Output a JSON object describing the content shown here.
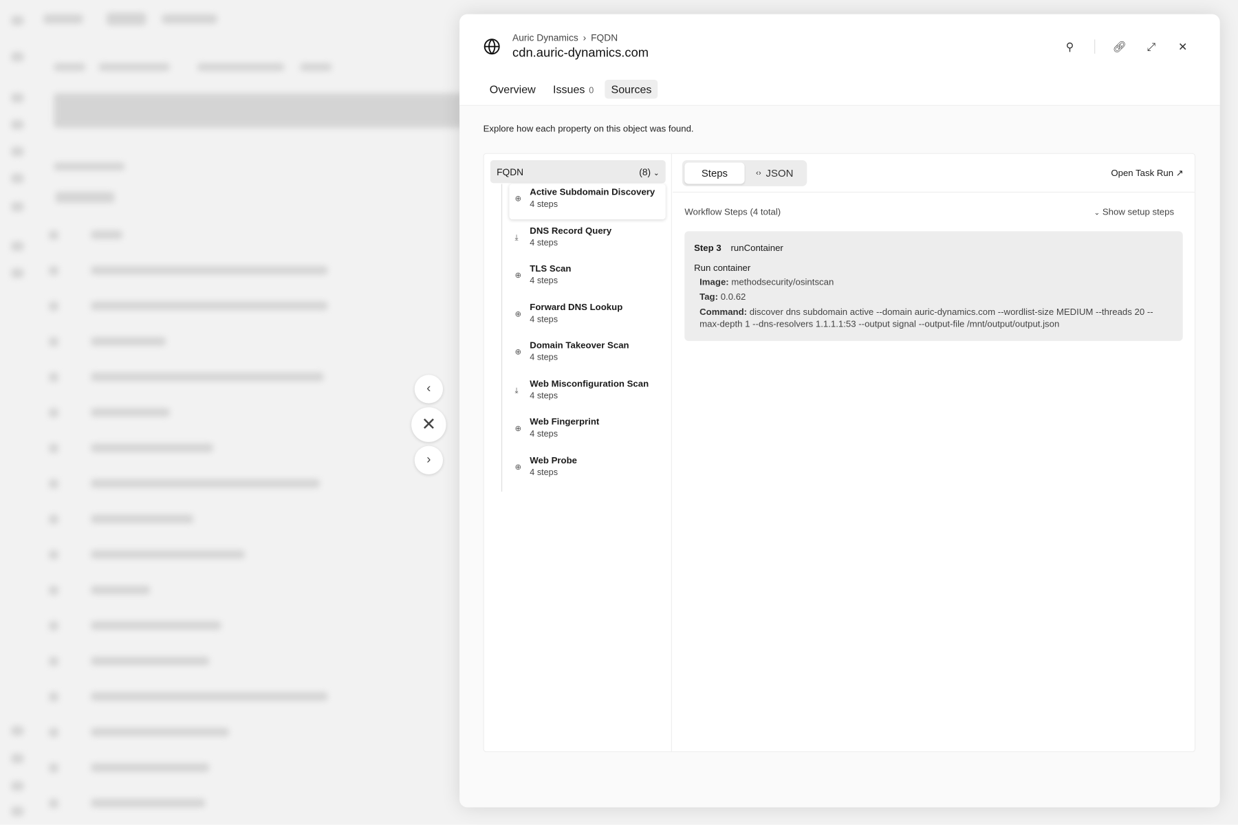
{
  "header": {
    "breadcrumb": [
      "Auric Dynamics",
      "FQDN"
    ],
    "title": "cdn.auric-dynamics.com"
  },
  "tabs": [
    {
      "label": "Overview"
    },
    {
      "label": "Issues",
      "count": "0"
    },
    {
      "label": "Sources"
    }
  ],
  "description": "Explore how each property on this object was found.",
  "group": {
    "label": "FQDN",
    "count": "(8)"
  },
  "sources": [
    {
      "name": "Active Subdomain Discovery",
      "steps": "4 steps",
      "icon": "search-icon"
    },
    {
      "name": "DNS Record Query",
      "steps": "4 steps",
      "icon": "download-icon"
    },
    {
      "name": "TLS Scan",
      "steps": "4 steps",
      "icon": "search-icon"
    },
    {
      "name": "Forward DNS Lookup",
      "steps": "4 steps",
      "icon": "search-icon"
    },
    {
      "name": "Domain Takeover Scan",
      "steps": "4 steps",
      "icon": "search-icon"
    },
    {
      "name": "Web Misconfiguration Scan",
      "steps": "4 steps",
      "icon": "download-icon"
    },
    {
      "name": "Web Fingerprint",
      "steps": "4 steps",
      "icon": "search-icon"
    },
    {
      "name": "Web Probe",
      "steps": "4 steps",
      "icon": "search-icon"
    }
  ],
  "view": {
    "steps": "Steps",
    "json": "JSON",
    "open_task_run": "Open Task Run",
    "workflow_title": "Workflow Steps (4 total)",
    "show_setup": "Show setup steps"
  },
  "step": {
    "number": "Step 3",
    "name": "runContainer",
    "title": "Run container",
    "image_label": "Image:",
    "image": "methodsecurity/osintscan",
    "tag_label": "Tag:",
    "tag": "0.0.62",
    "command_label": "Command:",
    "command": "discover dns subdomain active --domain auric-dynamics.com --wordlist-size MEDIUM --threads 20 --max-depth 1 --dns-resolvers 1.1.1.1:53 --output signal --output-file /mnt/output/output.json"
  }
}
